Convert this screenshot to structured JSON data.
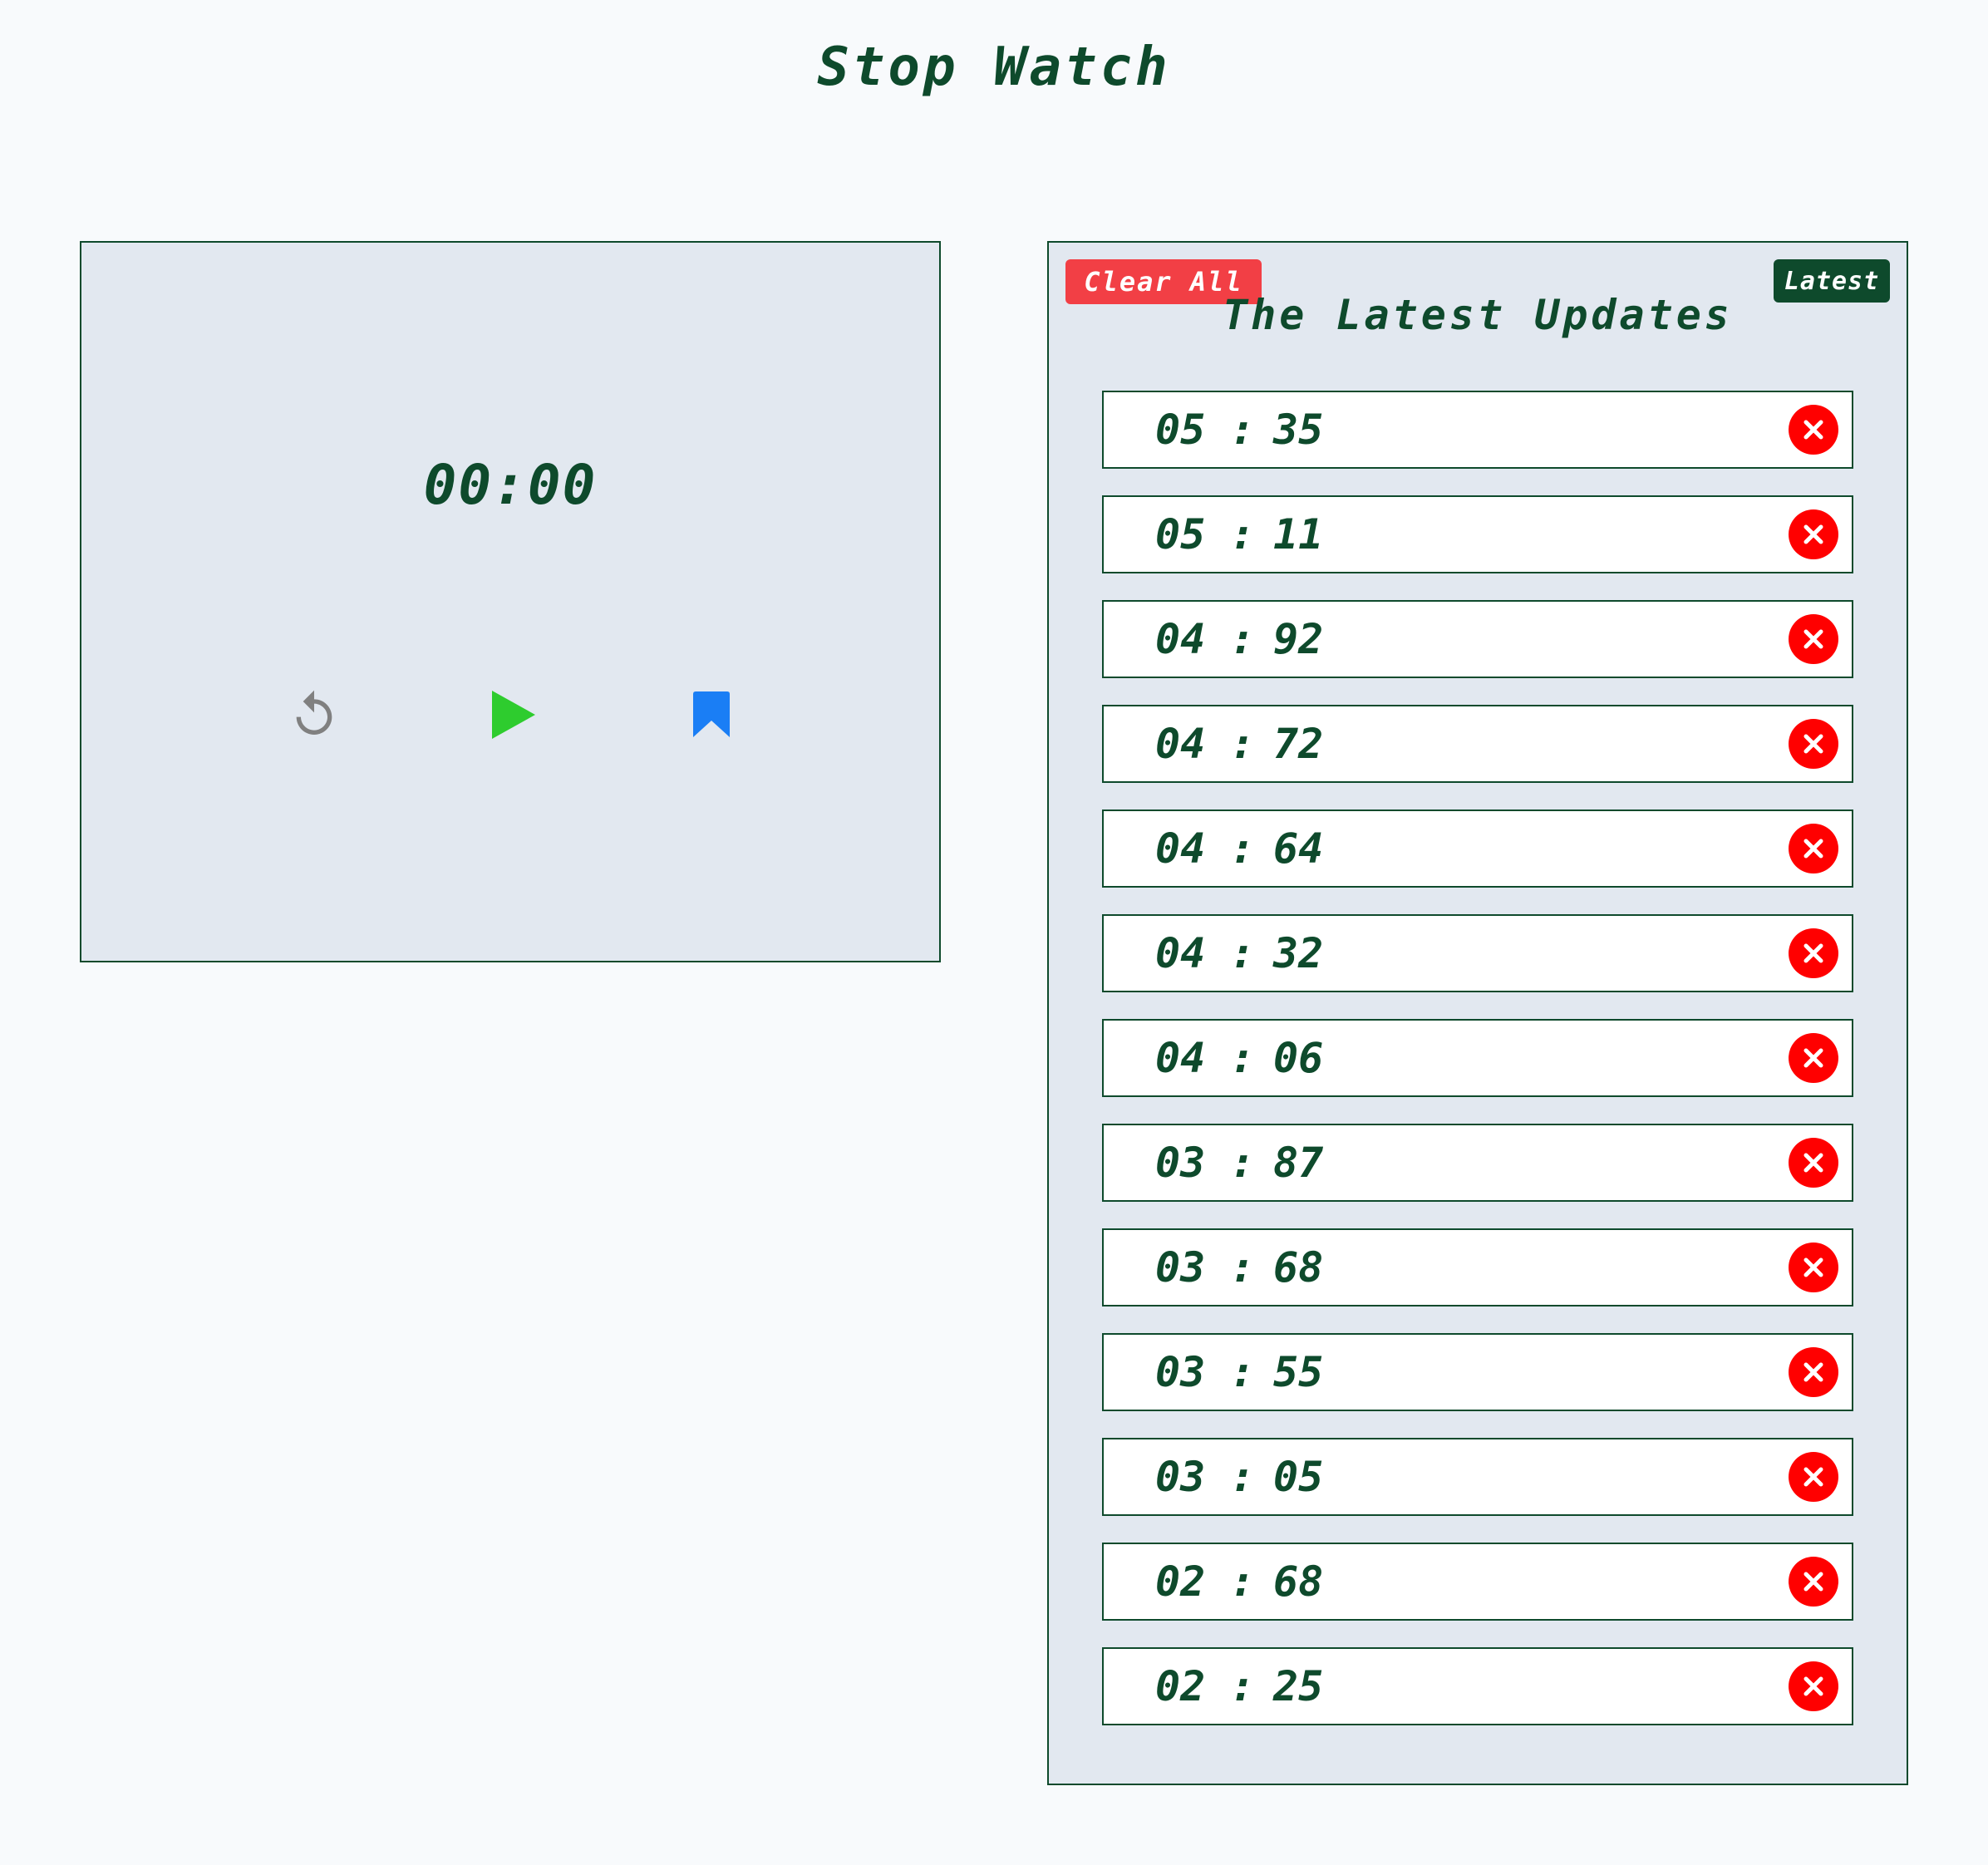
{
  "header": {
    "title": "Stop Watch"
  },
  "timer": {
    "display": "00:00",
    "controls": [
      {
        "name": "reset",
        "icon": "reset-icon",
        "color": "#808080"
      },
      {
        "name": "play",
        "icon": "play-icon",
        "color": "#2ecc2e"
      },
      {
        "name": "bookmark",
        "icon": "bookmark-icon",
        "color": "#1a7ef5"
      }
    ]
  },
  "updates": {
    "clear_label": "Clear All",
    "latest_label": "Latest",
    "heading": "The Latest Updates",
    "separator": ":",
    "laps": [
      {
        "min": "05",
        "sec": "35"
      },
      {
        "min": "05",
        "sec": "11"
      },
      {
        "min": "04",
        "sec": "92"
      },
      {
        "min": "04",
        "sec": "72"
      },
      {
        "min": "04",
        "sec": "64"
      },
      {
        "min": "04",
        "sec": "32"
      },
      {
        "min": "04",
        "sec": "06"
      },
      {
        "min": "03",
        "sec": "87"
      },
      {
        "min": "03",
        "sec": "68"
      },
      {
        "min": "03",
        "sec": "55"
      },
      {
        "min": "03",
        "sec": "05"
      },
      {
        "min": "02",
        "sec": "68"
      },
      {
        "min": "02",
        "sec": "25"
      }
    ]
  },
  "colors": {
    "primary": "#0e4a2c",
    "panel_bg": "#e2e8f0",
    "page_bg": "#f8fafc",
    "danger": "#f23f45",
    "delete": "#ff0000"
  }
}
